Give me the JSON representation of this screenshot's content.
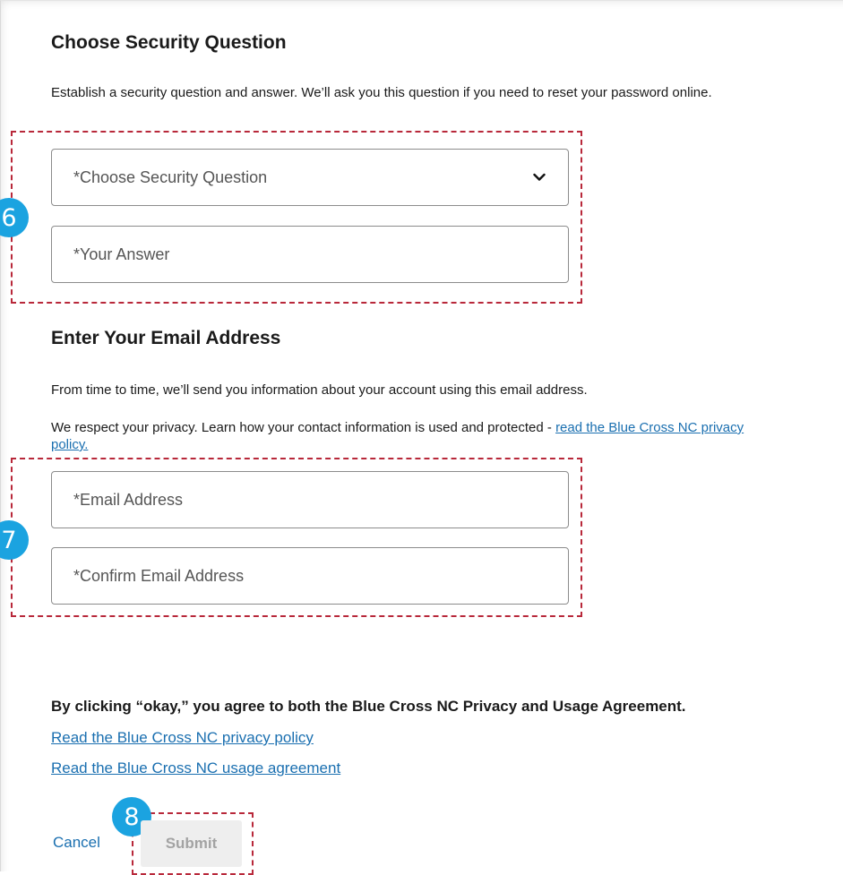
{
  "security": {
    "heading": "Choose Security Question",
    "description": "Establish a security question and answer. We’ll ask you this question if you need to reset your password online.",
    "question_select": "*Choose Security Question",
    "answer_placeholder": "*Your Answer"
  },
  "email": {
    "heading": "Enter Your Email Address",
    "info": "From time to time, we’ll send you information about your account using this email address.",
    "privacy_prefix": "We respect your privacy. Learn how your contact information is used and protected - ",
    "privacy_link": "read the Blue Cross NC privacy policy.",
    "email_placeholder": "*Email Address",
    "confirm_placeholder": "*Confirm Email Address"
  },
  "agreement": {
    "text": "By clicking “okay,” you agree to both the Blue Cross NC Privacy and Usage Agreement.",
    "privacy_link": "Read the Blue Cross NC privacy policy",
    "usage_link": "Read the Blue Cross NC usage agreement"
  },
  "actions": {
    "cancel": "Cancel",
    "submit": "Submit"
  },
  "callouts": {
    "step_security": "6",
    "step_email": "7",
    "step_submit": "8"
  },
  "colors": {
    "link": "#1a6fb0",
    "callout_badge": "#1ba3e0",
    "callout_outline": "#b8283a",
    "disabled_button": "#eeeeee"
  }
}
